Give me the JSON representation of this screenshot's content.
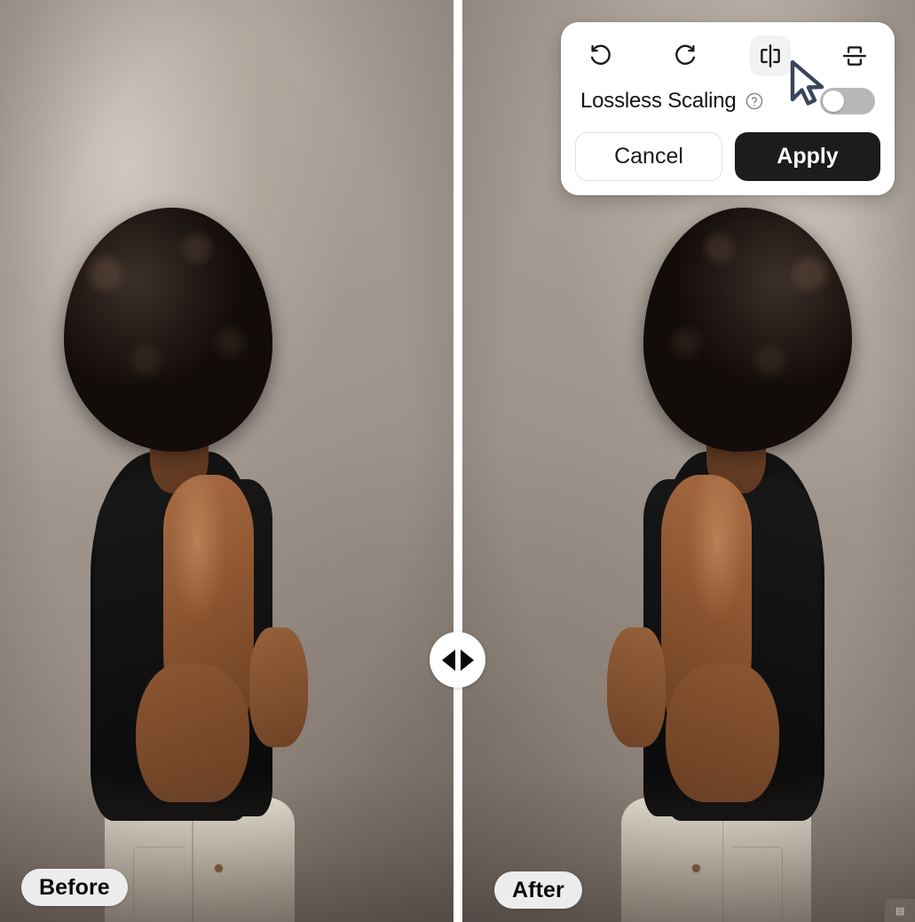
{
  "app": {
    "mode": "before-after-compare"
  },
  "compare": {
    "before_label": "Before",
    "after_label": "After",
    "handle_icon_left": "triangle-left-icon",
    "handle_icon_right": "triangle-right-icon",
    "divider_color": "#ffffff",
    "backdrop_color": "#9e948c"
  },
  "tool_panel": {
    "tools": [
      {
        "id": "rotate-left",
        "icon": "rotate-counterclockwise-icon",
        "active": false
      },
      {
        "id": "rotate-right",
        "icon": "rotate-clockwise-icon",
        "active": false
      },
      {
        "id": "flip-horizontal",
        "icon": "flip-horizontal-icon",
        "active": true
      },
      {
        "id": "flip-vertical",
        "icon": "flip-vertical-icon",
        "active": false
      }
    ],
    "option": {
      "label": "Lossless Scaling",
      "help_icon": "question-mark-circle-icon",
      "toggle_state": "off"
    },
    "actions": {
      "cancel_label": "Cancel",
      "apply_label": "Apply"
    },
    "colors": {
      "panel_bg": "#ffffff",
      "apply_bg": "#1c1c1c",
      "apply_text": "#ffffff",
      "cancel_bg": "#ffffff",
      "cancel_text": "#1b1b1b",
      "active_tool_bg": "#f2f2f2",
      "toggle_off_bg": "#b8b8b8"
    }
  },
  "cursor": {
    "icon": "mouse-pointer-icon",
    "color": "#3a455c"
  },
  "watermark": {
    "text": "▤"
  }
}
